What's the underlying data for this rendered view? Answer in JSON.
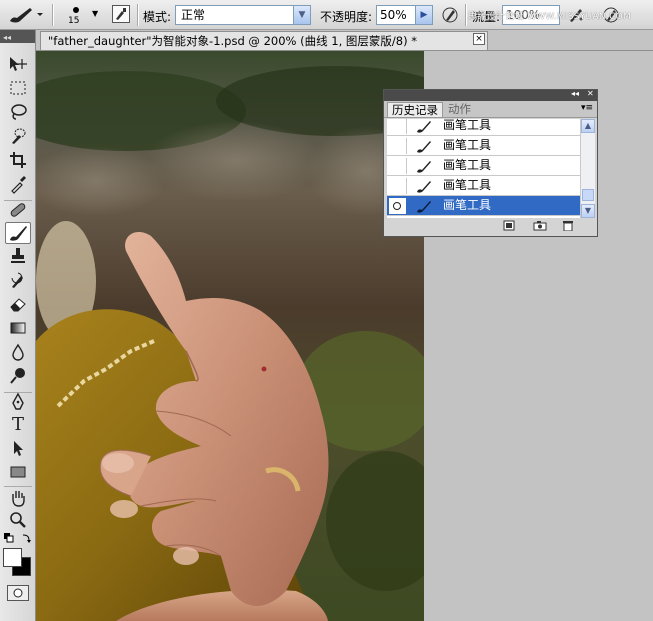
{
  "options_bar": {
    "brush_size": "15",
    "mode_label": "模式:",
    "mode_value": "正常",
    "opacity_label": "不透明度:",
    "opacity_value": "50%",
    "flow_label": "流量:",
    "flow_value": "100%",
    "watermark": "思缘设计论坛 WWW.MISSYUAN.COM"
  },
  "document": {
    "tab_title": "\"father_daughter\"为智能对象-1.psd @ 200% (曲线 1, 图层蒙版/8) *",
    "close_glyph": "×"
  },
  "history_panel": {
    "tabs": [
      "历史记录",
      "动作"
    ],
    "collapse_glyph": "◂◂",
    "close_glyph": "✕",
    "items": [
      {
        "label": "画笔工具",
        "selected": false
      },
      {
        "label": "画笔工具",
        "selected": false
      },
      {
        "label": "画笔工具",
        "selected": false
      },
      {
        "label": "画笔工具",
        "selected": false
      },
      {
        "label": "画笔工具",
        "selected": true
      }
    ]
  },
  "toolbox": {
    "tools": [
      "move-tool",
      "marquee-tool",
      "lasso-tool",
      "quick-select-tool",
      "crop-tool",
      "eyedropper-tool",
      "healing-brush-tool",
      "brush-tool",
      "clone-stamp-tool",
      "history-brush-tool",
      "eraser-tool",
      "gradient-tool",
      "blur-tool",
      "dodge-tool",
      "pen-tool",
      "type-tool",
      "path-selection-tool",
      "shape-tool",
      "hand-tool",
      "zoom-tool"
    ],
    "active_tool": "brush-tool",
    "type_glyph": "T"
  },
  "colors": {
    "foreground": "#ffffff",
    "background": "#000000",
    "selection": "#316ac5"
  }
}
